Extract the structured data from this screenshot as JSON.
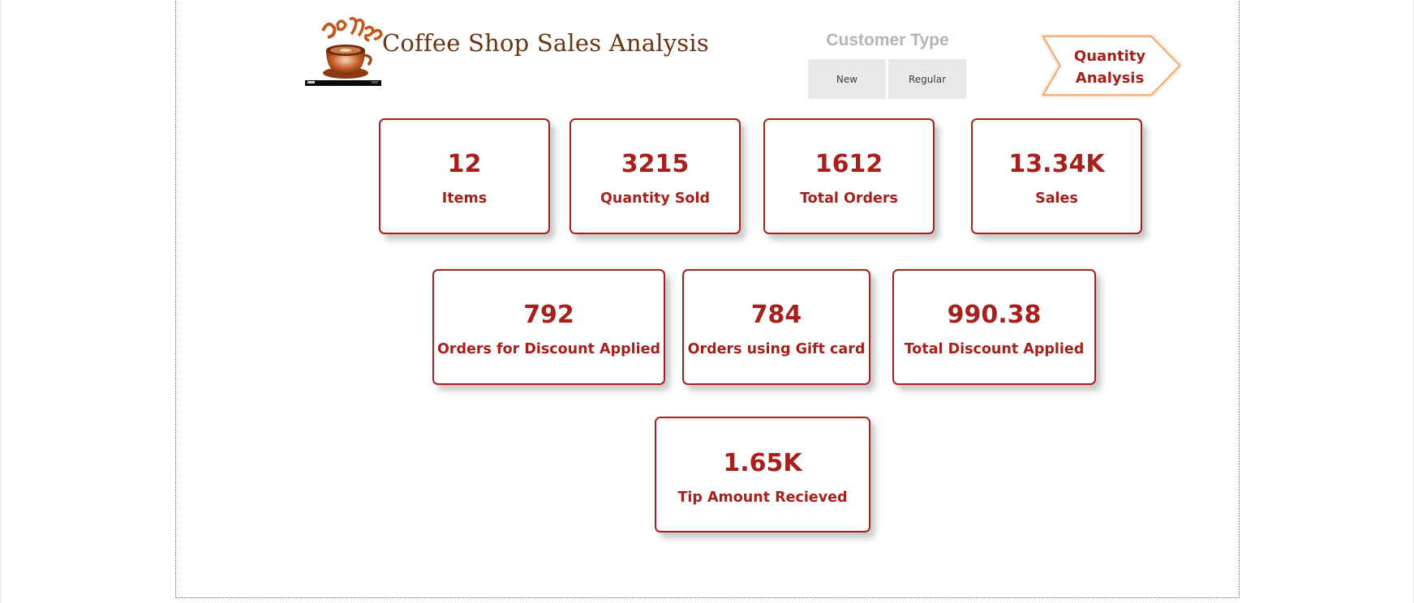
{
  "header": {
    "title": "Coffee Shop Sales Analysis",
    "logo_text": "Coffee"
  },
  "slicer": {
    "title": "Customer Type",
    "options": [
      "New",
      "Regular"
    ]
  },
  "navigation": {
    "button_line1": "Quantity",
    "button_line2": "Analysis"
  },
  "kpis": [
    {
      "value": "12",
      "label": "Items"
    },
    {
      "value": "3215",
      "label": "Quantity Sold"
    },
    {
      "value": "1612",
      "label": "Total Orders"
    },
    {
      "value": "13.34K",
      "label": "Sales"
    },
    {
      "value": "792",
      "label": "Orders for Discount Applied"
    },
    {
      "value": "784",
      "label": "Orders using Gift card"
    },
    {
      "value": "990.38",
      "label": "Total Discount Applied"
    },
    {
      "value": "1.65K",
      "label": "Tip Amount Recieved"
    }
  ],
  "colors": {
    "accent": "#a7201c",
    "title": "#6b3512",
    "nav_border": "#f39b5a",
    "slicer_bg": "#e9e9e9"
  },
  "icons": {
    "logo": "coffee-cup-logo-icon",
    "nav": "chevron-arrow-icon"
  }
}
